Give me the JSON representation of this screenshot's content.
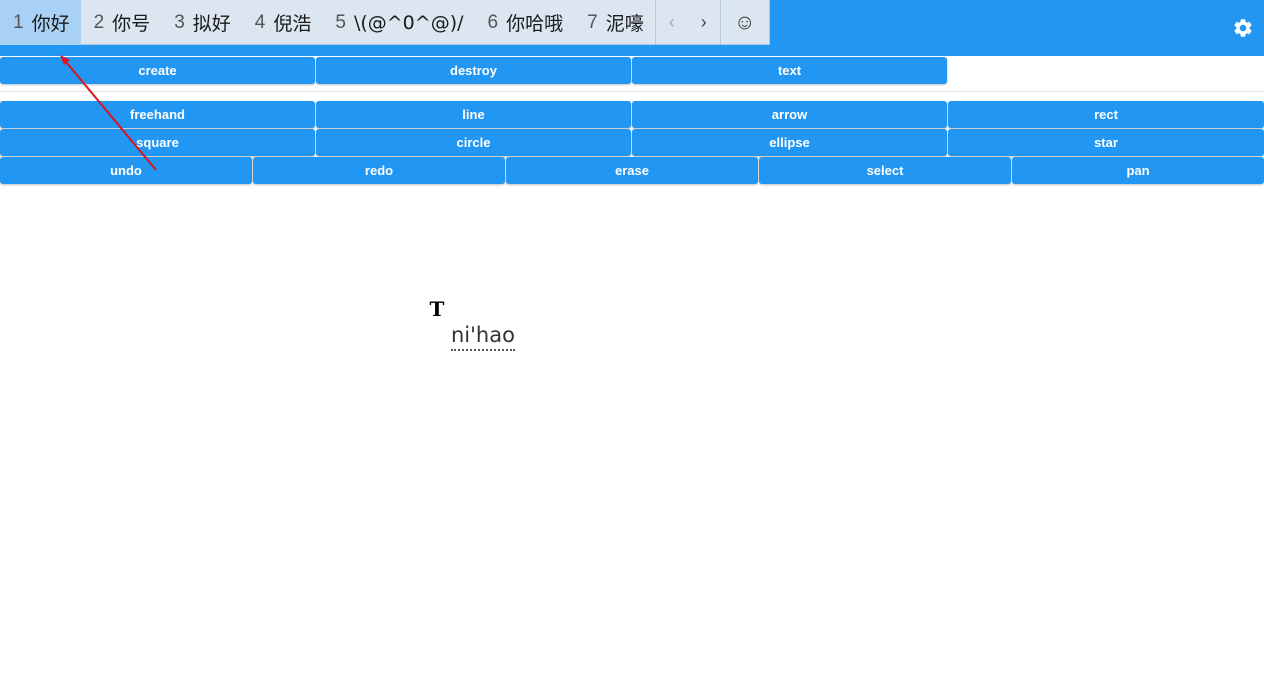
{
  "ime": {
    "candidates": [
      {
        "num": "1",
        "text": "你好"
      },
      {
        "num": "2",
        "text": "你号"
      },
      {
        "num": "3",
        "text": "拟好"
      },
      {
        "num": "4",
        "text": "倪浩"
      },
      {
        "num": "5",
        "text": "\\(@^0^@)/"
      },
      {
        "num": "6",
        "text": "你哈哦"
      },
      {
        "num": "7",
        "text": "泥嚎"
      }
    ],
    "prev_label": "‹",
    "next_label": "›",
    "emoji_label": "☺"
  },
  "row1": {
    "create": "create",
    "destroy": "destroy",
    "text": "text"
  },
  "shapes": {
    "freehand": "freehand",
    "line": "line",
    "arrow": "arrow",
    "rect": "rect",
    "square": "square",
    "circle": "circle",
    "ellipse": "ellipse",
    "star": "star"
  },
  "actions": {
    "undo": "undo",
    "redo": "redo",
    "erase": "erase",
    "select": "select",
    "pan": "pan"
  },
  "canvas": {
    "cursor_glyph": "T",
    "composing_text": "ni'hao"
  },
  "colors": {
    "primary": "#2196f3",
    "annotation_arrow": "#e0121b"
  },
  "icons": {
    "settings": "gear-icon"
  }
}
